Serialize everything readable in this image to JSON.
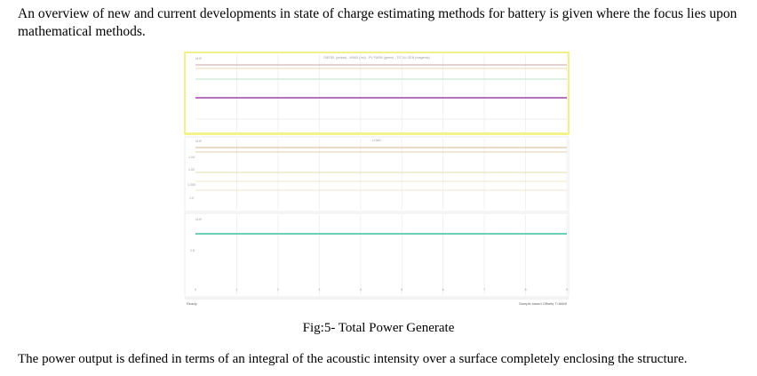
{
  "paragraph_top": "An overview of new and current developments in state of charge estimating methods for battery is given where the focus lies upon mathematical methods.",
  "figure": {
    "panel1_title": "DIESEL (yellow) - WIND (red) - PV FARM (green) - TOTAL GEN (magenta)",
    "panel2_title": "LOAD",
    "exp_label": "x10⁴",
    "panel2_ytick_labels": [
      "1.04",
      "1.02",
      "1.005",
      "1.0"
    ],
    "panel3_ytick_labels": [
      "1.6"
    ],
    "xtick_labels": [
      "0",
      "1",
      "2",
      "3",
      "4",
      "5",
      "6",
      "7",
      "8",
      "9"
    ],
    "status_left": "Ready",
    "status_right": "Sample based  Offsets  T=8849",
    "colors": {
      "diesel": "#eeea66",
      "wind": "#c28080",
      "pv": "#a6d6a6",
      "total": "#a043a7",
      "load_a": "#d9b38c",
      "load_b": "#e8ddb0",
      "panel3_line": "#3fbf9f"
    }
  },
  "caption": "Fig:5- Total Power Generate",
  "paragraph_bottom": "The power output is defined in terms of an integral of the acoustic intensity over a surface completely enclosing the structure."
}
